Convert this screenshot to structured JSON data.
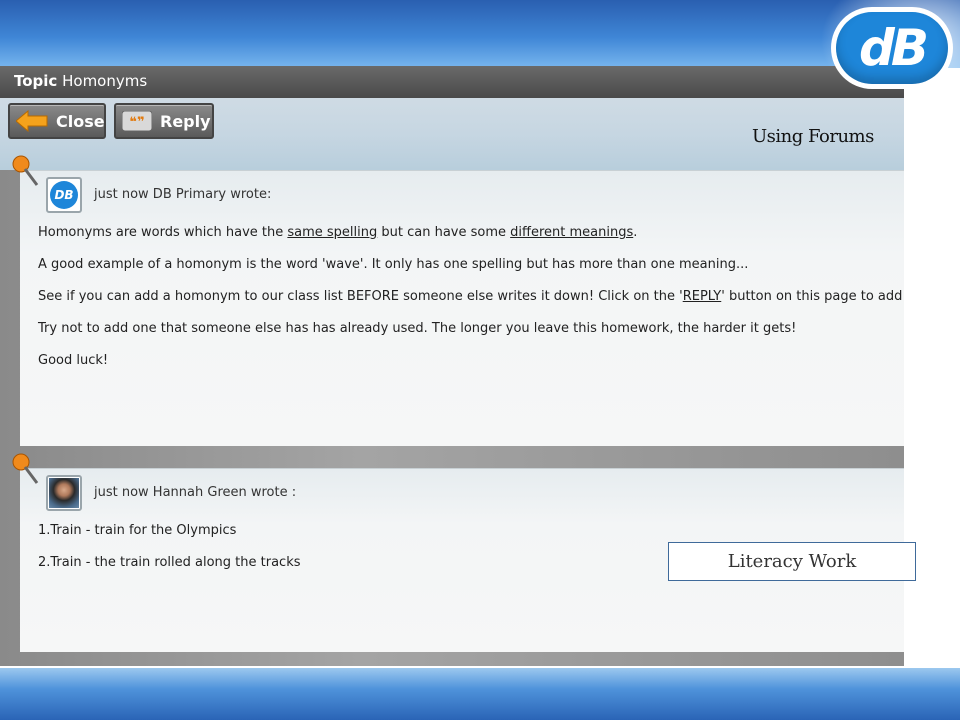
{
  "branding": {
    "logo_text": "dB",
    "accent_color": "#1e86d9"
  },
  "topic": {
    "label": "Topic",
    "title": "Homonyms"
  },
  "toolbar": {
    "close_label": "Close",
    "reply_label": "Reply"
  },
  "overlay": {
    "heading": "Using Forums",
    "caption": "Literacy Work"
  },
  "posts": [
    {
      "header": "just now DB Primary wrote:",
      "avatar_text": "DB",
      "lines": {
        "l1_a": "Homonyms are words which have the ",
        "l1_u1": "same spelling",
        "l1_b": " but can have some ",
        "l1_u2": "different meanings",
        "l1_c": ".",
        "l2": "A good example of a homonym is the word 'wave'. It only has one spelling but has more than one meaning...",
        "l3_a": "See if you can add a homonym to our class list BEFORE someone else writes it down! Click on the '",
        "l3_u": "REPLY",
        "l3_b": "' button on this page to add your words.",
        "l4": "Try not to add one that someone else has has already used. The longer you leave this homework, the harder it gets!",
        "l5": "Good luck!"
      }
    },
    {
      "header": "just now Hannah Green wrote :",
      "lines": {
        "l1": "1.Train - train for the Olympics",
        "l2": "2.Train - the train rolled along the tracks"
      }
    }
  ]
}
